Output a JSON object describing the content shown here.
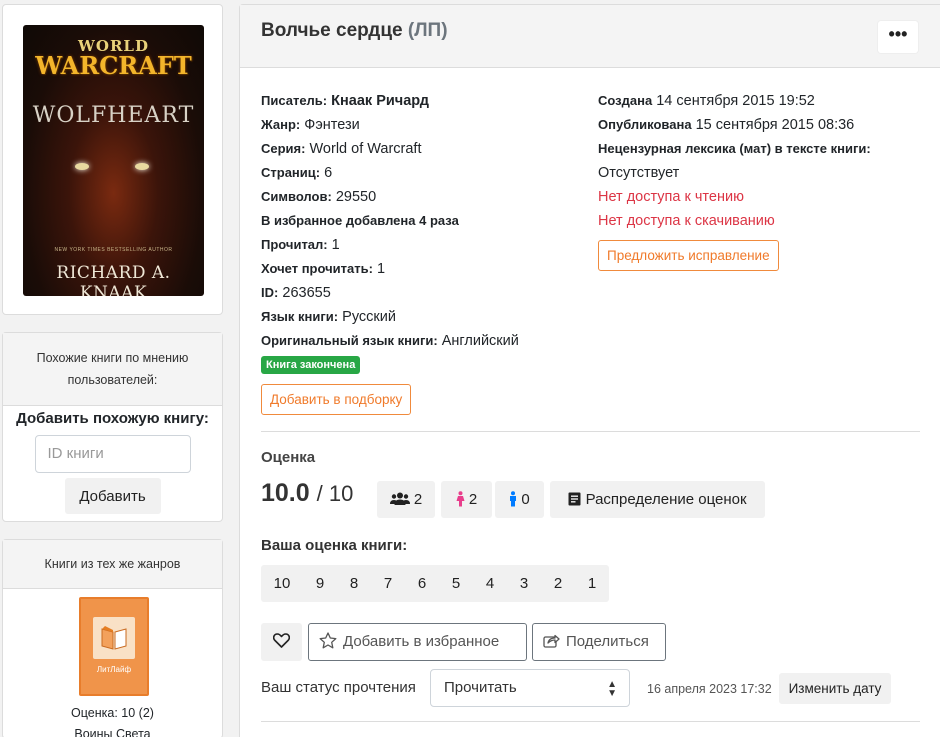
{
  "cover": {
    "series_top": "WORLD",
    "series_main": "WARCRAFT",
    "book_word": "WOLFHEART",
    "tagline": "NEW YORK TIMES BESTSELLING AUTHOR",
    "author": "RICHARD A. KNAAK"
  },
  "similar": {
    "header": "Похожие книги по мнению пользователей:",
    "add_title": "Добавить похожую книгу:",
    "input_placeholder": "ID книги",
    "add_button": "Добавить"
  },
  "genre_books": {
    "header": "Книги из тех же жанров",
    "book_cover_label": "ЛитЛайф",
    "book_rating": "Оценка: 10 (2)",
    "book_title": "Воины Света"
  },
  "book": {
    "title": "Волчье сердце",
    "title_suffix": "(ЛП)",
    "more_button": "•••",
    "left_info": [
      {
        "label": "Писатель:",
        "value": "Кнаак Ричард",
        "value_bold": true
      },
      {
        "label": "Жанр:",
        "value": "Фэнтези"
      },
      {
        "label": "Серия:",
        "value": "World of Warcraft"
      },
      {
        "label": "Страниц:",
        "value": "6"
      },
      {
        "label": "Символов:",
        "value": "29550"
      },
      {
        "label": "В избранное добавлена 4 раза",
        "value": ""
      },
      {
        "label": "Прочитал:",
        "value": "1"
      },
      {
        "label": "Хочет прочитать:",
        "value": "1"
      },
      {
        "label": "ID:",
        "value": "263655"
      },
      {
        "label": "Язык книги:",
        "value": "Русский"
      },
      {
        "label": "Оригинальный язык книги:",
        "value": "Английский"
      }
    ],
    "completed_badge": "Книга закончена",
    "add_to_collection": "Добавить в подборку",
    "right_info": {
      "created_label": "Создана",
      "created_value": "14 сентября 2015 19:52",
      "published_label": "Опубликована",
      "published_value": "15 сентября 2015 08:36",
      "profanity_label": "Нецензурная лексика (мат) в тексте книги:",
      "profanity_value": "Отсутствует",
      "no_read": "Нет доступа к чтению",
      "no_download": "Нет доступа к скачиванию",
      "suggest_fix": "Предложить исправление"
    }
  },
  "rating": {
    "label": "Оценка",
    "value": "10.0",
    "max": "/ 10",
    "votes_all": "2",
    "votes_female": "2",
    "votes_male": "0",
    "distribution_button": "Распределение оценок",
    "your_rating_label": "Ваша оценка книги:",
    "scores": [
      "10",
      "9",
      "8",
      "7",
      "6",
      "5",
      "4",
      "3",
      "2",
      "1"
    ]
  },
  "actions": {
    "favorite": "Добавить в избранное",
    "share": "Поделиться"
  },
  "status": {
    "label": "Ваш статус прочтения",
    "selected": "Прочитать",
    "date": "16 апреля 2023 17:32",
    "change_date": "Изменить дату"
  },
  "colors": {
    "accent_orange": "#f07a2a",
    "danger_red": "#dc3545",
    "success_green": "#28a745"
  }
}
